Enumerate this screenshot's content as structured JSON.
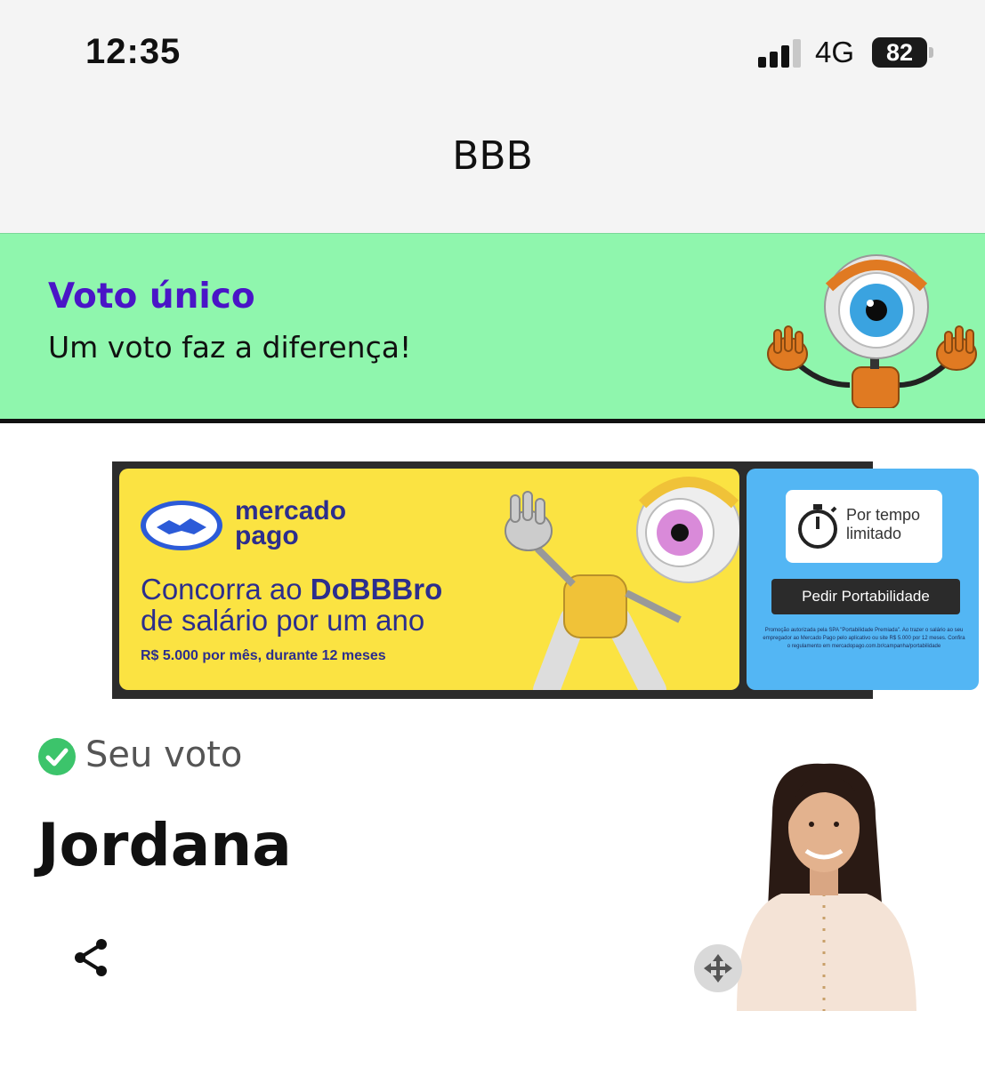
{
  "status_bar": {
    "time": "12:35",
    "network": "4G",
    "battery": "82"
  },
  "nav": {
    "title": "BBB"
  },
  "banner": {
    "title": "Voto único",
    "subtitle": "Um voto faz a diferença!"
  },
  "ad": {
    "brand_line1": "mercado",
    "brand_line2": "pago",
    "headline_part1": "Concorra ao ",
    "headline_bold": "DoBBBro",
    "headline_part2": "de salário por um ano",
    "small_text": "R$ 5.000 por mês, durante 12 meses",
    "timer_line1": "Por tempo",
    "timer_line2": "limitado",
    "button_label": "Pedir Portabilidade",
    "fine_print": "Promoção autorizada pela SPA \"Portabilidade Premiada\". Ao trazer o salário ao seu empregador ao Mercado Pago pelo aplicativo ou site R$ 5.000 por 12 meses. Confira o regulamento em mercadopago.com.br/campanha/portabilidade"
  },
  "vote": {
    "label": "Seu voto",
    "candidate": "Jordana"
  },
  "colors": {
    "banner_bg": "#8ff6ad",
    "banner_title": "#4a15c7",
    "check_green": "#3cc46b",
    "ad_yellow": "#fbe342",
    "ad_blue": "#53b6f4"
  },
  "icons": {
    "check": "check-circle-icon",
    "share": "share-icon",
    "move": "move-arrows-icon"
  }
}
